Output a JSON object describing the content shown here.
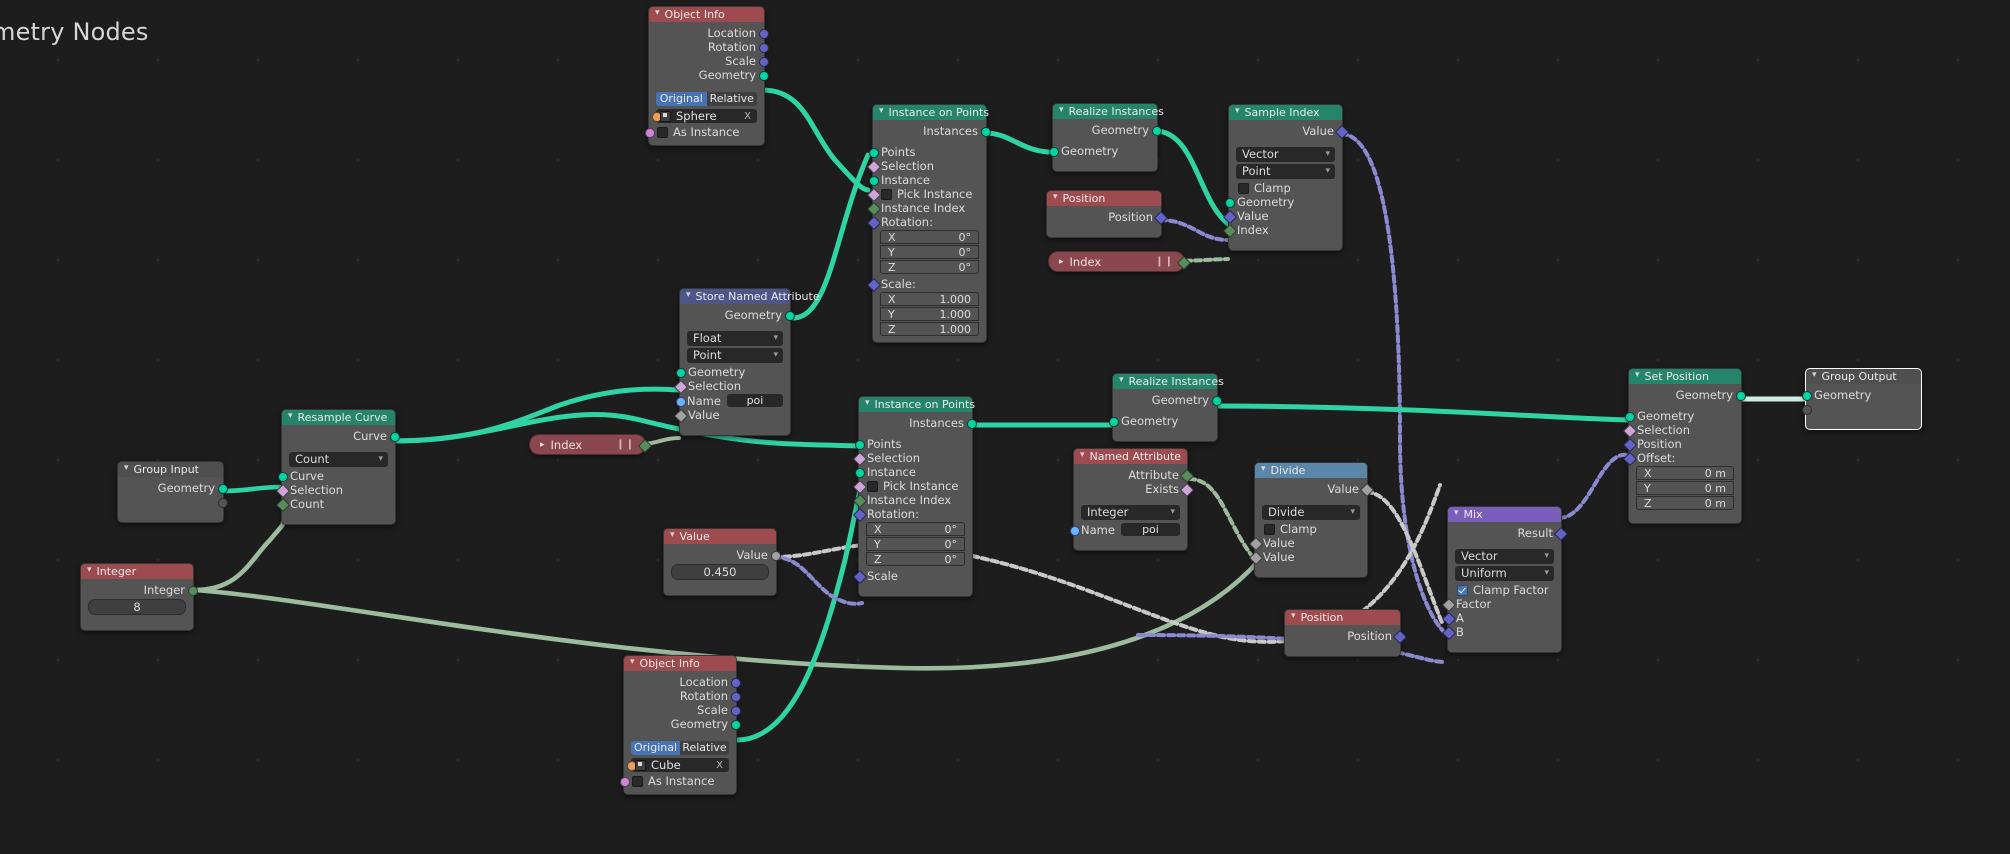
{
  "editor": {
    "title": "metry Nodes",
    "background": "#1d1d1d"
  },
  "colors": {
    "header_geometry": "#25856a",
    "header_input": "#9d4b4f",
    "header_attribute": "#4d5589",
    "header_converter": "#5a86a8",
    "header_vector": "#7b5ebb",
    "header_group": "#4f4f4f",
    "socket_geometry": "#00d6a3",
    "socket_vector": "#6363c7",
    "socket_boolean": "#cca6d6",
    "socket_integer": "#598c5c",
    "socket_float": "#a1a1a1",
    "socket_string": "#70b2ff",
    "socket_object": "#ed9e5c",
    "accent_blue": "#4772b3"
  },
  "nodes": {
    "object_info_sphere": {
      "title": "Object Info",
      "outputs": [
        "Location",
        "Rotation",
        "Scale",
        "Geometry"
      ],
      "toggle": {
        "options": [
          "Original",
          "Relative"
        ],
        "selected": "Original"
      },
      "object": "Sphere",
      "object_clear": "X",
      "as_instance_label": "As Instance",
      "as_instance_checked": false
    },
    "instance_on_points_1": {
      "title": "Instance on Points",
      "outputs": [
        "Instances"
      ],
      "inputs": [
        "Points",
        "Selection",
        "Instance",
        "Pick Instance",
        "Instance Index",
        "Rotation:"
      ],
      "pick_instance_checked": false,
      "rotation": {
        "label": "Rotation:",
        "x_label": "X",
        "y_label": "Y",
        "z_label": "Z",
        "x": "0°",
        "y": "0°",
        "z": "0°"
      },
      "scale": {
        "label": "Scale:",
        "x_label": "X",
        "y_label": "Y",
        "z_label": "Z",
        "x": "1.000",
        "y": "1.000",
        "z": "1.000"
      }
    },
    "realize_instances_1": {
      "title": "Realize Instances",
      "outputs": [
        "Geometry"
      ],
      "inputs": [
        "Geometry"
      ]
    },
    "sample_index": {
      "title": "Sample Index",
      "outputs": [
        "Value"
      ],
      "data_type": "Vector",
      "domain": "Point",
      "clamp_label": "Clamp",
      "clamp_checked": false,
      "inputs": [
        "Geometry",
        "Value",
        "Index"
      ]
    },
    "position_1": {
      "title": "Position",
      "outputs": [
        "Position"
      ]
    },
    "index_1": {
      "title": "Index",
      "collapsed": true,
      "dots": "❙❙"
    },
    "store_named_attribute": {
      "title": "Store Named Attribute",
      "outputs": [
        "Geometry"
      ],
      "data_type": "Float",
      "domain": "Point",
      "inputs": [
        "Geometry",
        "Selection",
        "Name",
        "Value"
      ],
      "name_label": "Name",
      "name_value": "poi"
    },
    "resample_curve": {
      "title": "Resample Curve",
      "outputs": [
        "Curve"
      ],
      "mode": "Count",
      "inputs": [
        "Curve",
        "Selection",
        "Count"
      ]
    },
    "group_input": {
      "title": "Group Input",
      "outputs": [
        "Geometry"
      ]
    },
    "integer": {
      "title": "Integer",
      "outputs": [
        "Integer"
      ],
      "value": "8"
    },
    "index_2": {
      "title": "Index",
      "collapsed": true,
      "dots": "❙❙"
    },
    "value_node": {
      "title": "Value",
      "outputs": [
        "Value"
      ],
      "value": "0.450"
    },
    "instance_on_points_2": {
      "title": "Instance on Points",
      "outputs": [
        "Instances"
      ],
      "inputs": [
        "Points",
        "Selection",
        "Instance",
        "Pick Instance",
        "Instance Index",
        "Rotation:",
        "Scale"
      ],
      "pick_instance_checked": false,
      "rotation": {
        "label": "Rotation:",
        "x_label": "X",
        "y_label": "Y",
        "z_label": "Z",
        "x": "0°",
        "y": "0°",
        "z": "0°"
      },
      "scale_label": "Scale"
    },
    "realize_instances_2": {
      "title": "Realize Instances",
      "outputs": [
        "Geometry"
      ],
      "inputs": [
        "Geometry"
      ]
    },
    "named_attribute": {
      "title": "Named Attribute",
      "outputs": [
        "Attribute",
        "Exists"
      ],
      "data_type": "Integer",
      "name_label": "Name",
      "name_value": "poi"
    },
    "divide": {
      "title": "Divide",
      "outputs": [
        "Value"
      ],
      "operation": "Divide",
      "clamp_label": "Clamp",
      "clamp_checked": false,
      "inputs": [
        "Value",
        "Value"
      ]
    },
    "position_2": {
      "title": "Position",
      "outputs": [
        "Position"
      ]
    },
    "mix": {
      "title": "Mix",
      "outputs": [
        "Result"
      ],
      "data_type": "Vector",
      "factor_mode": "Uniform",
      "clamp_factor_label": "Clamp Factor",
      "clamp_factor_checked": true,
      "inputs": [
        "Factor",
        "A",
        "B"
      ]
    },
    "object_info_cube": {
      "title": "Object Info",
      "outputs": [
        "Location",
        "Rotation",
        "Scale",
        "Geometry"
      ],
      "toggle": {
        "options": [
          "Original",
          "Relative"
        ],
        "selected": "Original"
      },
      "object": "Cube",
      "object_clear": "X",
      "as_instance_label": "As Instance",
      "as_instance_checked": false
    },
    "set_position": {
      "title": "Set Position",
      "outputs": [
        "Geometry"
      ],
      "inputs": [
        "Geometry",
        "Selection",
        "Position",
        "Offset:"
      ],
      "offset": {
        "label": "Offset:",
        "x_label": "X",
        "y_label": "Y",
        "z_label": "Z",
        "x": "0 m",
        "y": "0 m",
        "z": "0 m"
      }
    },
    "group_output": {
      "title": "Group Output",
      "inputs": [
        "Geometry"
      ]
    }
  }
}
